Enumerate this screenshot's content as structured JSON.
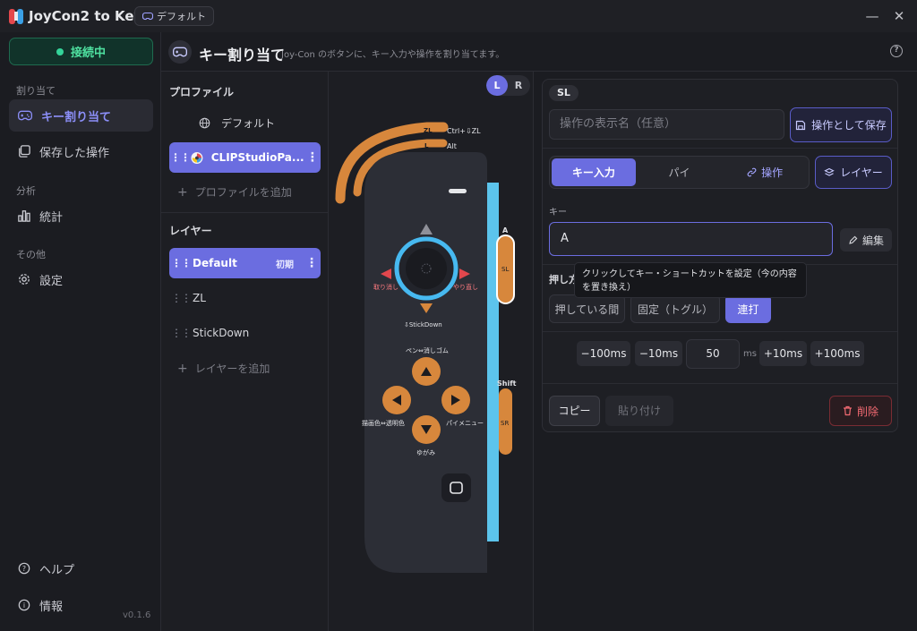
{
  "app": {
    "title": "JoyCon2 to Key",
    "profile_chip": "デフォルト",
    "version": "v0.1.6"
  },
  "window": {
    "minimize": "—",
    "close": "✕"
  },
  "nav": {
    "connection": "接続中",
    "section_assign": "割り当て",
    "items_assign": [
      {
        "label": "キー割り当て",
        "icon": "gamepad-icon",
        "active": true
      },
      {
        "label": "保存した操作",
        "icon": "copy-stack-icon",
        "active": false
      }
    ],
    "section_analysis": "分析",
    "items_analysis": [
      {
        "label": "統計",
        "icon": "bar-chart-icon"
      }
    ],
    "section_other": "その他",
    "items_other": [
      {
        "label": "設定",
        "icon": "gear-icon"
      }
    ],
    "help": "ヘルプ",
    "info": "情報"
  },
  "header": {
    "title": "キー割り当て",
    "subtitle": "Joy-Con のボタンに、キー入力や操作を割り当てます。"
  },
  "profiles": {
    "heading": "プロファイル",
    "items": [
      {
        "label": "デフォルト",
        "icon": "globe-icon",
        "selected": false
      },
      {
        "label": "CLIPStudioPa...",
        "icon": "clipstudio-app-icon",
        "selected": true
      }
    ],
    "add": "プロファイルを追加"
  },
  "layers": {
    "heading": "レイヤー",
    "items": [
      {
        "label": "Default",
        "badge": "初期",
        "selected": true
      },
      {
        "label": "ZL",
        "selected": false
      },
      {
        "label": "StickDown",
        "selected": false
      }
    ],
    "add": "レイヤーを追加"
  },
  "controller": {
    "side_toggle": {
      "left": "L",
      "right": "R",
      "selected": "L"
    },
    "labels": {
      "zl": "ZL",
      "l": "L",
      "zl_action": "Ctrl+⇩ZL",
      "l_action": "Alt",
      "stick_left": "取り消し",
      "stick_right": "やり直し",
      "stick_down": "⇩StickDown",
      "up_action": "ペン⇔消しゴム",
      "left_action": "描画色⇔透明色",
      "right_action": "パイメニュー",
      "down_action": "ゆがみ",
      "rail_top": "A",
      "sl": "SL",
      "sr": "SR",
      "sr_action": "Shift"
    },
    "colors": {
      "accent": "#d7873c",
      "rail": "#5cc4ec",
      "stick_ring": "#47b9f0",
      "arrow": "#e2474d"
    }
  },
  "editor": {
    "button_name": "SL",
    "display_name_placeholder": "操作の表示名（任意）",
    "save_as_op": "操作として保存",
    "tabs": [
      {
        "label": "キー入力",
        "selected": true
      },
      {
        "label": "パイ",
        "selected": false
      },
      {
        "label": "操作",
        "selected": false
      }
    ],
    "layer_button": "レイヤー",
    "key_label": "キー",
    "key_value": "A",
    "edit_button": "編集",
    "tooltip": "クリックしてキー・ショートカットを設定（今の内容を置き換え）",
    "press_label": "押し方",
    "modes": [
      {
        "label": "押している間",
        "selected": false
      },
      {
        "label": "固定（トグル）",
        "selected": false
      },
      {
        "label": "連打",
        "selected": true
      }
    ],
    "steps": [
      "−100ms",
      "−10ms",
      "+10ms",
      "+100ms"
    ],
    "interval_value": "50",
    "interval_unit": "ms",
    "copy": "コピー",
    "paste": "貼り付け",
    "delete": "削除"
  }
}
